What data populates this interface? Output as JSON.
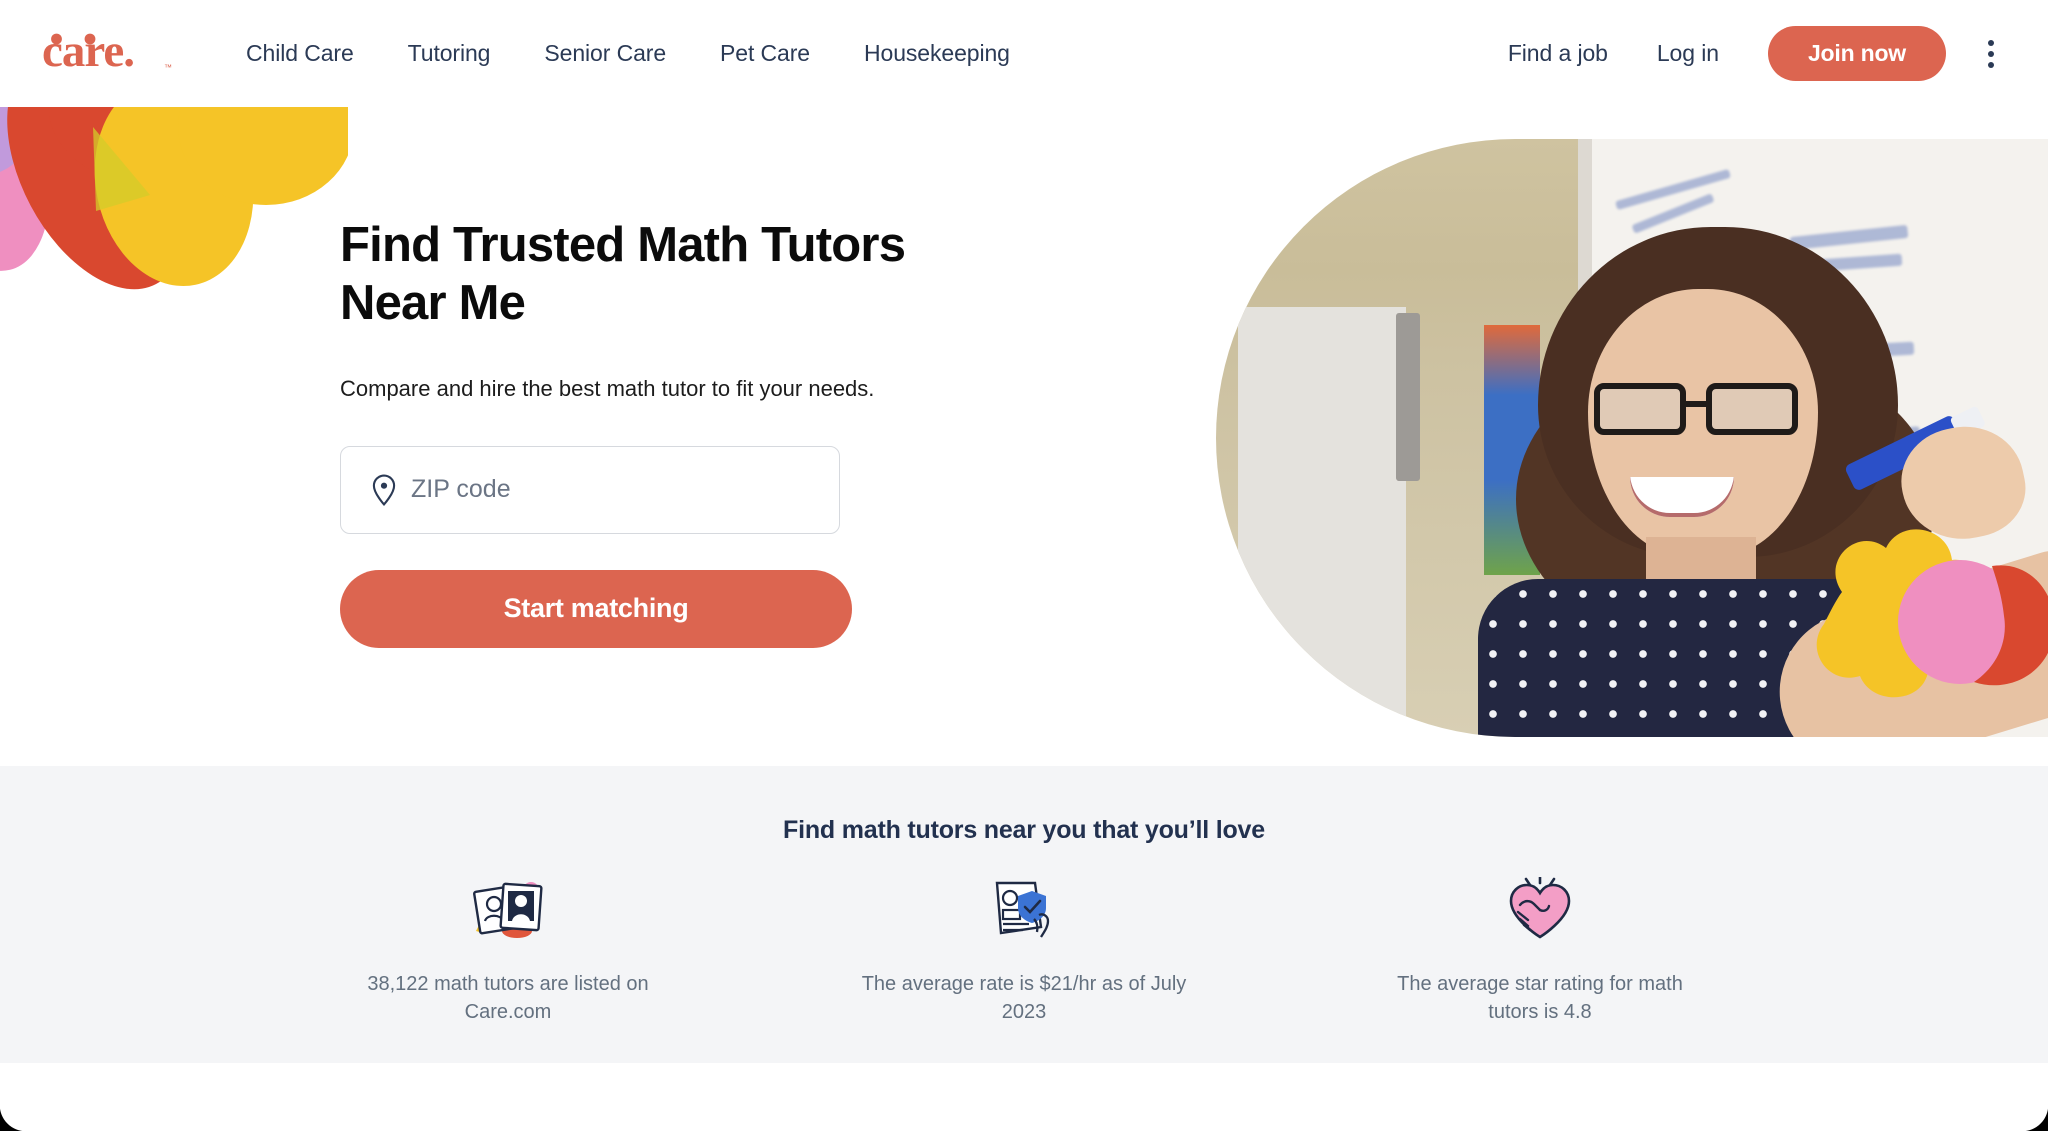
{
  "header": {
    "logo_text": "care.",
    "nav": [
      {
        "label": "Child Care"
      },
      {
        "label": "Tutoring"
      },
      {
        "label": "Senior Care"
      },
      {
        "label": "Pet Care"
      },
      {
        "label": "Housekeeping"
      }
    ],
    "find_job_label": "Find a job",
    "login_label": "Log in",
    "join_label": "Join now",
    "menu_icon": "kebab-menu-icon"
  },
  "hero": {
    "title": "Find Trusted Math Tutors Near Me",
    "subtitle": "Compare and hire the best math tutor to fit your needs.",
    "zip": {
      "placeholder": "ZIP code",
      "value": "",
      "icon": "location-pin-icon"
    },
    "cta_label": "Start matching",
    "photo_alt": "Smiling tutor with glasses writing math on a whiteboard with a blue marker"
  },
  "stats": {
    "title": "Find math tutors near you that you’ll love",
    "items": [
      {
        "icon": "photo-frames-icon",
        "text": "38,122 math tutors are listed on Care.com"
      },
      {
        "icon": "verified-profile-icon",
        "text": "The average rate is $21/hr as of July 2023"
      },
      {
        "icon": "heart-handshake-icon",
        "text": "The average star rating for math tutors is 4.8"
      }
    ]
  },
  "colors": {
    "brand_coral": "#dc6550",
    "navy": "#2b3a55",
    "stats_bg": "#f4f5f7",
    "deco_yellow": "#f5c427",
    "deco_pink": "#ef8fc0",
    "deco_red": "#d9482f",
    "stat_text": "#63707f"
  }
}
